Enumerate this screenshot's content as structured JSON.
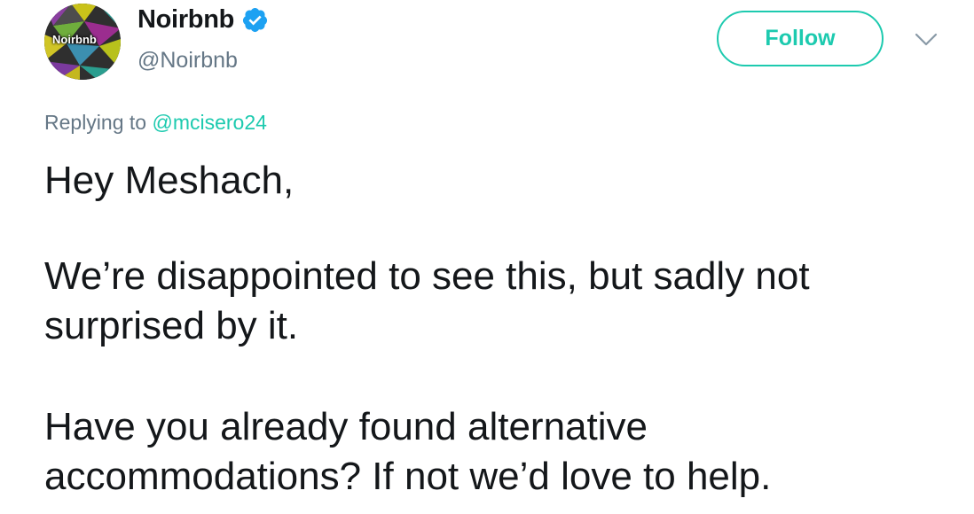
{
  "author": {
    "avatar_text": "Noirbnb",
    "display_name": "Noirbnb",
    "handle": "@Noirbnb",
    "verified_icon": "verified-badge-icon"
  },
  "actions": {
    "follow_label": "Follow",
    "more_icon": "chevron-down-icon"
  },
  "reply": {
    "prefix": "Replying to",
    "mention": "@mcisero24"
  },
  "tweet": {
    "lines": [
      "Hey Meshach,",
      "We’re disappointed to see this, but sadly not",
      "surprised by it.",
      "Have you already found alternative",
      "accommodations? If not we’d love to help."
    ]
  },
  "colors": {
    "accent": "#1dcaaf",
    "verified": "#1da1f2",
    "secondary_text": "#657786",
    "primary_text": "#14171a"
  }
}
